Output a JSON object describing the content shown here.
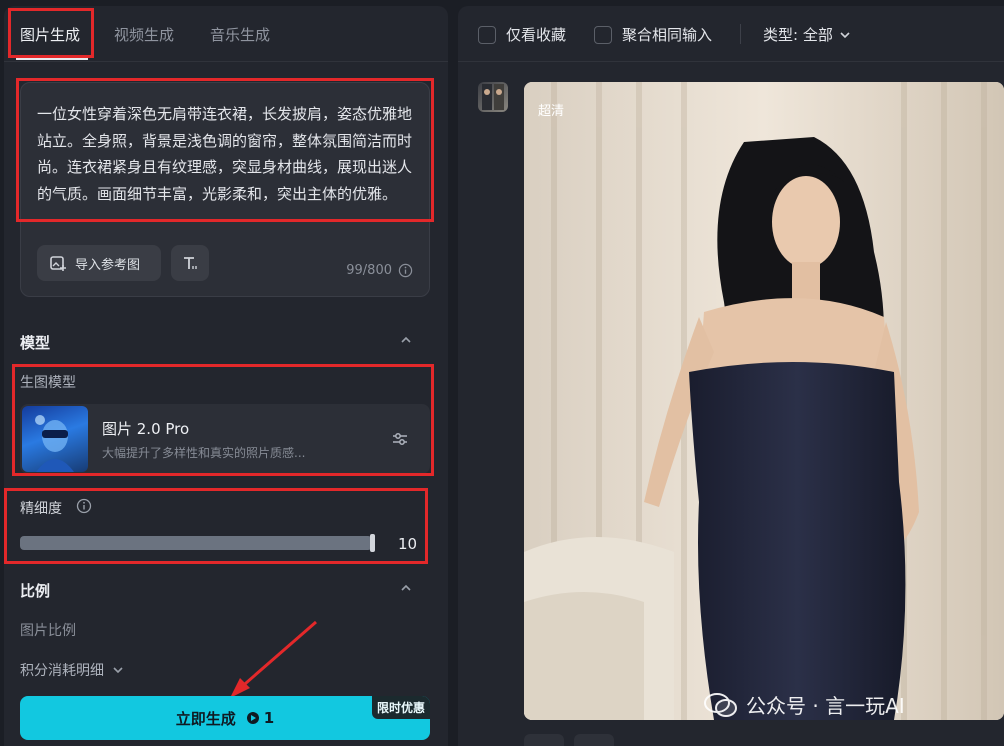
{
  "tabs": [
    {
      "label": "图片生成",
      "active": true
    },
    {
      "label": "视频生成",
      "active": false
    },
    {
      "label": "音乐生成",
      "active": false
    }
  ],
  "prompt": {
    "text": "一位女性穿着深色无肩带连衣裙，长发披肩，姿态优雅地站立。全身照，背景是浅色调的窗帘，整体氛围简洁而时尚。连衣裙紧身且有纹理感，突显身材曲线，展现出迷人的气质。画面细节丰富，光影柔和，突出主体的优雅。",
    "ref_button": "导入参考图",
    "counter": "99/800"
  },
  "model": {
    "section_title": "模型",
    "label": "生图模型",
    "name": "图片 2.0 Pro",
    "desc": "大幅提升了多样性和真实的照片质感..."
  },
  "precision": {
    "label": "精细度",
    "value": "10",
    "fill_fraction": 1.0
  },
  "ratio": {
    "section_title": "比例",
    "label": "图片比例"
  },
  "cost": {
    "label": "积分消耗明细"
  },
  "generate": {
    "label": "立即生成",
    "count": "1",
    "promo": "限时优惠"
  },
  "toolbar": {
    "favorites_label": "仅看收藏",
    "merge_label": "聚合相同输入",
    "type_label": "类型: 全部"
  },
  "result": {
    "badge": "超清"
  },
  "watermark": {
    "text": "公众号 · 言一玩AI"
  },
  "colors": {
    "accent": "#12c8e0",
    "annotation": "#e3282a",
    "panel": "#23262e"
  }
}
